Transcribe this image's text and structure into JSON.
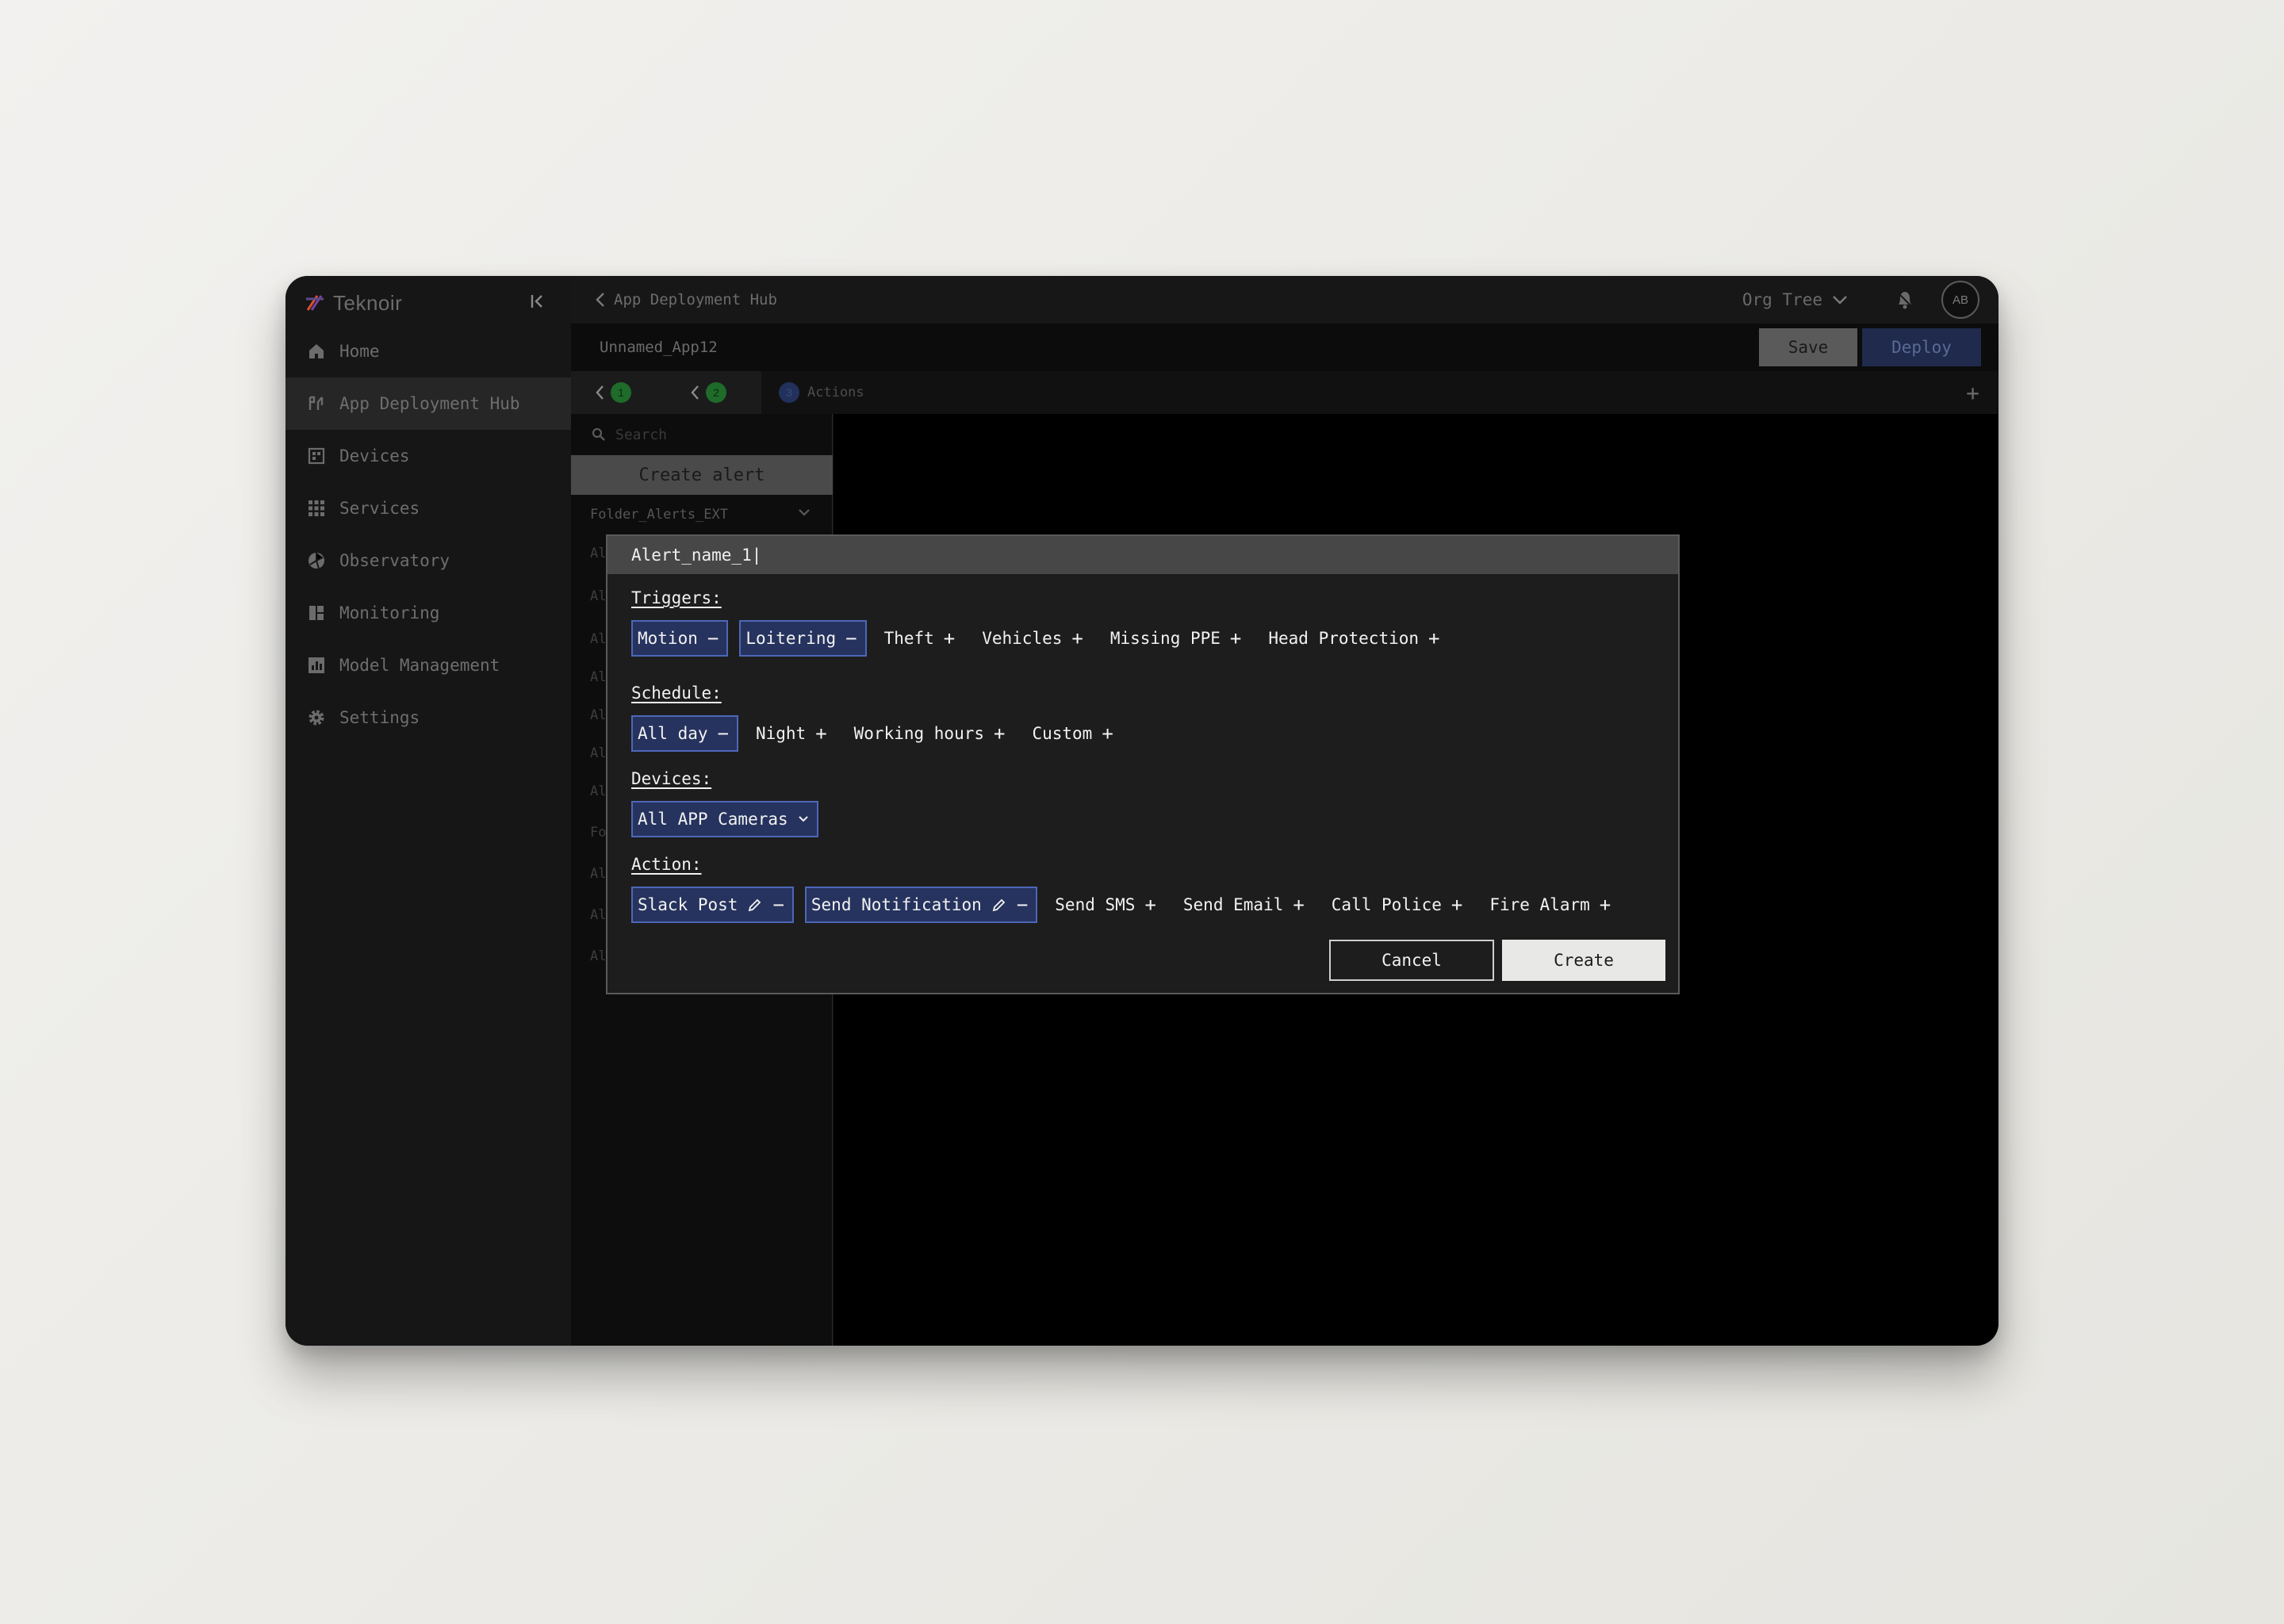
{
  "sidebar": {
    "logo_text": "Teknoir",
    "items": [
      {
        "label": "Home",
        "icon": "home-icon"
      },
      {
        "label": "App Deployment Hub",
        "icon": "deployment-icon",
        "active": true
      },
      {
        "label": "Devices",
        "icon": "devices-icon"
      },
      {
        "label": "Services",
        "icon": "grid-icon"
      },
      {
        "label": "Observatory",
        "icon": "observatory-icon"
      },
      {
        "label": "Monitoring",
        "icon": "monitoring-icon"
      },
      {
        "label": "Model Management",
        "icon": "chart-icon"
      },
      {
        "label": "Settings",
        "icon": "gear-icon"
      }
    ]
  },
  "topbar": {
    "breadcrumb": "App Deployment Hub",
    "org_tree_label": "Org Tree",
    "avatar_initials": "AB"
  },
  "app": {
    "name": "Unnamed_App12",
    "save_label": "Save",
    "deploy_label": "Deploy"
  },
  "steps": {
    "step1": "1",
    "step2": "2",
    "step3": "3",
    "step3_label": "Actions"
  },
  "list": {
    "search_placeholder": "Search",
    "create_label": "Create alert",
    "folder_label": "Folder_Alerts_EXT",
    "stubs": [
      "Al",
      "Al",
      "Al",
      "Al",
      "Al",
      "Al",
      "Al",
      "Fo",
      "Al",
      "Al",
      "Al"
    ]
  },
  "dialog": {
    "title_value": "Alert_name_1|",
    "triggers_label": "Triggers:",
    "triggers": [
      {
        "label": "Motion",
        "selected": true
      },
      {
        "label": "Loitering",
        "selected": true
      },
      {
        "label": "Theft",
        "selected": false
      },
      {
        "label": "Vehicles",
        "selected": false
      },
      {
        "label": "Missing PPE",
        "selected": false
      },
      {
        "label": "Head Protection",
        "selected": false
      }
    ],
    "schedule_label": "Schedule:",
    "schedule": [
      {
        "label": "All day",
        "selected": true
      },
      {
        "label": "Night",
        "selected": false
      },
      {
        "label": "Working hours",
        "selected": false
      },
      {
        "label": "Custom",
        "selected": false
      }
    ],
    "devices_label": "Devices:",
    "devices_value": "All APP Cameras",
    "action_label": "Action:",
    "actions": [
      {
        "label": "Slack Post",
        "selected": true
      },
      {
        "label": "Send Notification",
        "selected": true
      },
      {
        "label": "Send SMS",
        "selected": false
      },
      {
        "label": "Send Email",
        "selected": false
      },
      {
        "label": "Call Police",
        "selected": false
      },
      {
        "label": "Fire Alarm",
        "selected": false
      }
    ],
    "cancel_label": "Cancel",
    "create_label": "Create"
  },
  "colors": {
    "selected_fill": "#26335e",
    "selected_border": "#4d67b8",
    "deploy_fill": "#1f2a4d"
  }
}
